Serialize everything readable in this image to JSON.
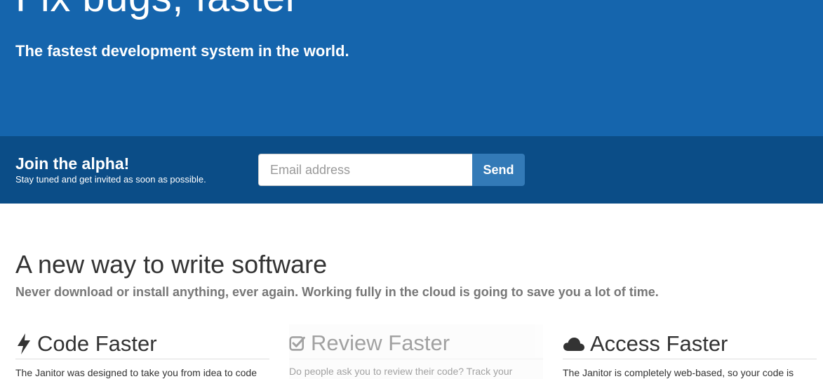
{
  "hero": {
    "title": "Fix bugs, faster",
    "subtitle": "The fastest development system in the world.",
    "background_color": "#1565ad"
  },
  "signup": {
    "title": "Join the alpha!",
    "tagline": "Stay tuned and get invited as soon as possible.",
    "email_placeholder": "Email address",
    "send_label": "Send",
    "background_color": "#0b4d87",
    "button_color": "#337ab7"
  },
  "intro": {
    "title": "A new way to write software",
    "lead": "Never download or install anything, ever again. Working fully in the cloud is going to save you a lot of time."
  },
  "features": [
    {
      "icon": "lightning-icon",
      "title": "Code Faster",
      "text": "The Janitor was designed to take you from idea to code"
    },
    {
      "icon": "checkbox-icon",
      "title": "Review Faster",
      "text": "Do people ask you to review their code? Track your"
    },
    {
      "icon": "cloud-icon",
      "title": "Access Faster",
      "text": "The Janitor is completely web-based, so your code is"
    }
  ]
}
